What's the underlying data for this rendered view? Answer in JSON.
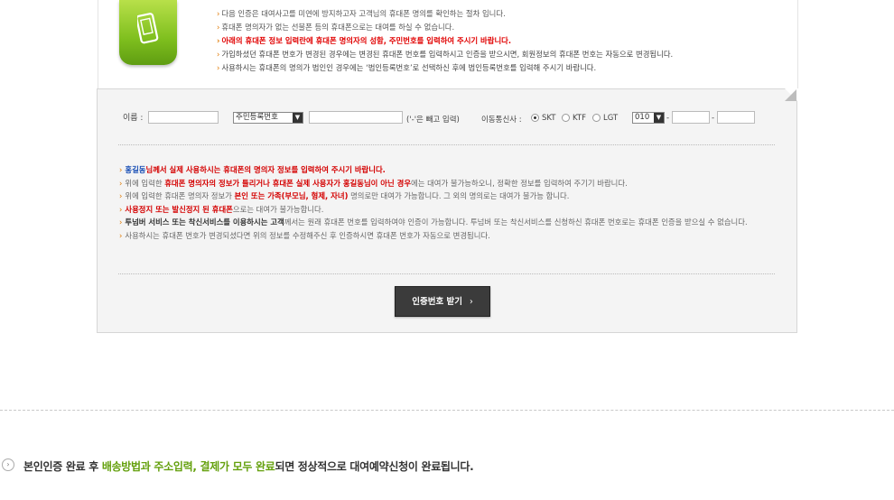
{
  "notice_top": [
    {
      "text": "다음 인증은 대여사고를 미연에 방지하고자 고객님의 휴대폰 명의를 확인하는 절차 입니다.",
      "style": "normal"
    },
    {
      "text": "휴대폰 명의자가 없는 선불폰 등의 휴대폰으로는 대여를 하실 수 없습니다.",
      "style": "normal"
    },
    {
      "text": "아래의 휴대폰 정보 입력란에 휴대폰 명의자의 성함, 주민번호를 입력하여 주시기 바랍니다.",
      "style": "red"
    },
    {
      "text": "가입하셨던 휴대폰 번호가 변경된 경우에는 변경된 휴대폰 번호를 입력하시고 인증을 받으시면, 회원정보의 휴대폰 번호는 자동으로 변경됩니다.",
      "style": "dark"
    },
    {
      "text": "사용하시는 휴대폰의 명의가 법인인 경우에는 ‘법인등록번호’로 선택하신 후에 법인등록번호를 입력해 주시기 바랍니다.",
      "style": "dark"
    }
  ],
  "form": {
    "name_label": "이름 :",
    "id_type": "주민등록번호",
    "id_hint": "('-'은 빼고 입력)",
    "carrier_label": "이동통신사 :",
    "carriers": [
      "SKT",
      "KTF",
      "LGT"
    ],
    "selected_carrier": "SKT",
    "phone_prefix": "010",
    "dash": "-"
  },
  "notice_form": {
    "line1": {
      "bl": "홍길동",
      "r": "님께서 실제 사용하시는 휴대폰의 명의자 정보를 입력하여 주시기 바랍니다."
    },
    "line2": {
      "a": "위에 입력한 ",
      "r": "휴대폰 명의자의 정보가 틀리거나 휴대폰 실제 사용자가 홍길동님이 아닌 경우",
      "c": "에는 대여가 불가능하오니, 정확한 정보를 입력하여 주기기 바랍니다."
    },
    "line3": {
      "a": "위에 입력한 휴대폰 명의자 정보가 ",
      "r": "본인 또는 가족(부모님, 형제, 자녀)",
      "c": " 명의로만 대여가 가능합니다. 그 외의 명의로는 대여가 불가능 합니다."
    },
    "line4": {
      "r": "사용정지 또는 발신정지 된 휴대폰",
      "c": "으로는 대여가 불가능합니다."
    },
    "line5": {
      "b": "투넘버 서비스 또는 착신서비스를 이용하시는 고객",
      "c": "께서는 원래 휴대폰 번호를 입력하여야 인증이 가능합니다. 투넘버 또는 착신서비스를 신청하신 휴대폰 번호로는 휴대폰 인증을 받으실 수 없습니다."
    },
    "line6": "사용하시는 휴대폰 번호가 변경되셨다면 위의 정보를 수정해주신 후 인증하시면 휴대폰 번호가 자동으로 변경됩니다."
  },
  "button": {
    "label": "인증번호 받기",
    "chevron": "›"
  },
  "bottom": {
    "icon": "circle-chevron-icon",
    "a": "본인인증 완료 후 ",
    "g": "배송방법과 주소입력, 결제가 모두 완료",
    "c": "되면 정상적으로 대여예약신청이 완료됩니다."
  }
}
